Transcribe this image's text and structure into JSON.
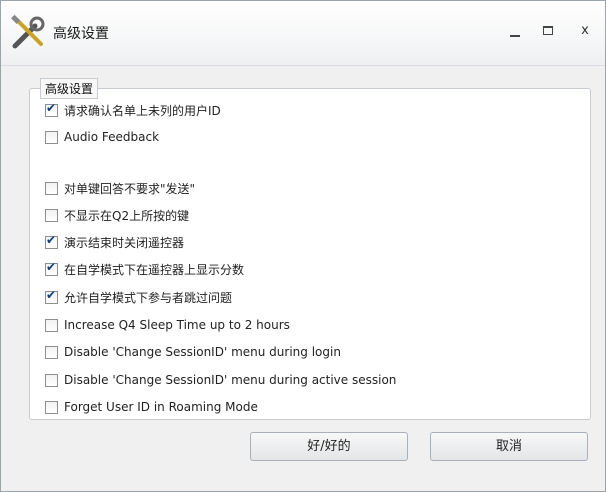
{
  "window": {
    "title": "高级设置",
    "minimize_glyph": "",
    "maximize_glyph": "",
    "close_glyph": "x",
    "app_icon": "tools-icon"
  },
  "group": {
    "legend": "高级设置",
    "options": [
      {
        "label": "请求确认名单上未列的用户ID",
        "checked": true
      },
      {
        "label": "Audio Feedback",
        "checked": false
      },
      {
        "label": "对单键回答不要求\"发送\"",
        "checked": false
      },
      {
        "label": "不显示在Q2上所按的键",
        "checked": false
      },
      {
        "label": "演示结束时关闭遥控器",
        "checked": true
      },
      {
        "label": "在自学模式下在遥控器上显示分数",
        "checked": true
      },
      {
        "label": "允许自学模式下参与者跳过问题",
        "checked": true
      },
      {
        "label": "Increase Q4 Sleep Time up to 2 hours",
        "checked": false
      },
      {
        "label": "Disable 'Change SessionID' menu during login",
        "checked": false
      },
      {
        "label": "Disable 'Change SessionID' menu during active session",
        "checked": false
      },
      {
        "label": "Forget User ID in Roaming Mode",
        "checked": false
      }
    ]
  },
  "buttons": {
    "ok": "好/好的",
    "cancel": "取消"
  }
}
